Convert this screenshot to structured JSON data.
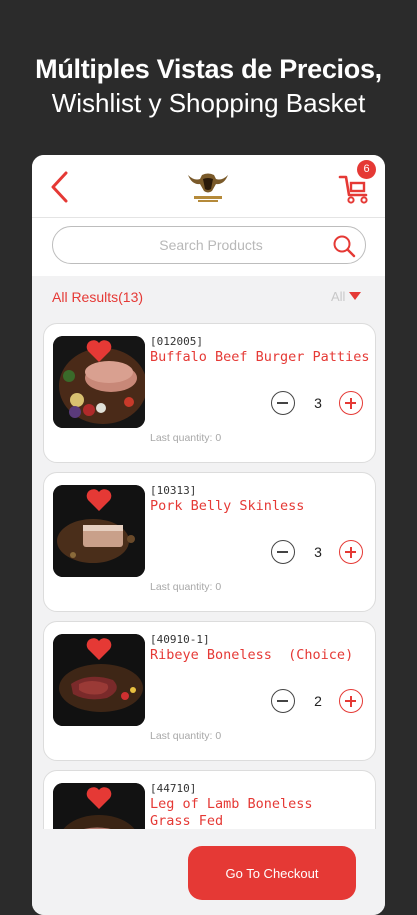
{
  "promo": {
    "line1": "Múltiples Vistas de Precios,",
    "line2": "Wishlist y Shopping Basket"
  },
  "header": {
    "back_icon": "chevron-left-icon",
    "cart_icon": "cart-icon",
    "cart_count": "6"
  },
  "search": {
    "placeholder": "Search Products",
    "value": ""
  },
  "results": {
    "count_label": "All Results(13)",
    "filter_label": "All"
  },
  "products": [
    {
      "code": "[012005]",
      "name": "Buffalo Beef Burger Patties",
      "qty": "3",
      "last": "Last quantity: 0"
    },
    {
      "code": "[10313]",
      "name": "Pork Belly Skinless",
      "qty": "3",
      "last": "Last quantity: 0"
    },
    {
      "code": "[40910-1]",
      "name": "Ribeye Boneless  (Choice)",
      "qty": "2",
      "last": "Last quantity: 0"
    },
    {
      "code": "[44710]",
      "name": "Leg of Lamb Boneless Grass Fed",
      "qty": "",
      "last": ""
    }
  ],
  "checkout": {
    "label": "Go To Checkout"
  },
  "colors": {
    "accent": "#e53935",
    "dark_bg": "#2b2b2b",
    "screen_bg": "#f2f2f3"
  }
}
